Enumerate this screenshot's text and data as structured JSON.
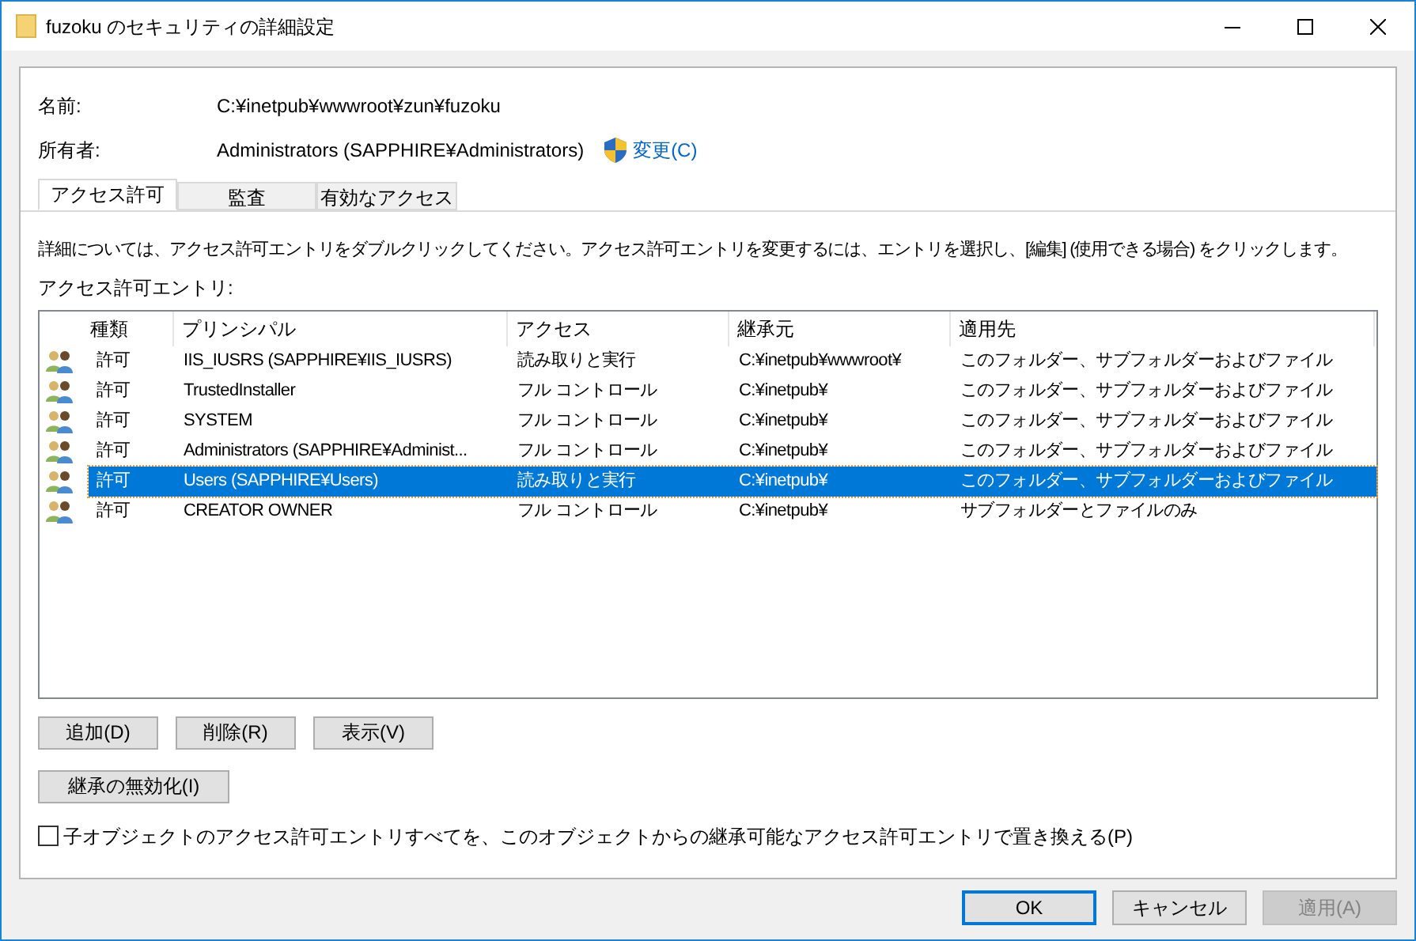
{
  "window": {
    "title": "fuzoku のセキュリティの詳細設定"
  },
  "name": {
    "label": "名前:",
    "value": "C:¥inetpub¥wwwroot¥zun¥fuzoku"
  },
  "owner": {
    "label": "所有者:",
    "value": "Administrators (SAPPHIRE¥Administrators)",
    "change_link": "変更(C)"
  },
  "tabs": [
    {
      "label": "アクセス許可",
      "selected": true
    },
    {
      "label": "監査",
      "selected": false
    },
    {
      "label": "有効なアクセス",
      "selected": false
    }
  ],
  "instructions": "詳細については、アクセス許可エントリをダブルクリックしてください。アクセス許可エントリを変更するには、エントリを選択し、[編集] (使用できる場合) をクリックします。",
  "list_label": "アクセス許可エントリ:",
  "table": {
    "columns": [
      "種類",
      "プリンシパル",
      "アクセス",
      "継承元",
      "適用先"
    ],
    "rows": [
      {
        "type": "許可",
        "principal": "IIS_IUSRS (SAPPHIRE¥IIS_IUSRS)",
        "access": "読み取りと実行",
        "inherited_from": "C:¥inetpub¥wwwroot¥",
        "applies_to": "このフォルダー、サブフォルダーおよびファイル",
        "selected": false
      },
      {
        "type": "許可",
        "principal": "TrustedInstaller",
        "access": "フル コントロール",
        "inherited_from": "C:¥inetpub¥",
        "applies_to": "このフォルダー、サブフォルダーおよびファイル",
        "selected": false
      },
      {
        "type": "許可",
        "principal": "SYSTEM",
        "access": "フル コントロール",
        "inherited_from": "C:¥inetpub¥",
        "applies_to": "このフォルダー、サブフォルダーおよびファイル",
        "selected": false
      },
      {
        "type": "許可",
        "principal": "Administrators (SAPPHIRE¥Administ...",
        "access": "フル コントロール",
        "inherited_from": "C:¥inetpub¥",
        "applies_to": "このフォルダー、サブフォルダーおよびファイル",
        "selected": false
      },
      {
        "type": "許可",
        "principal": "Users (SAPPHIRE¥Users)",
        "access": "読み取りと実行",
        "inherited_from": "C:¥inetpub¥",
        "applies_to": "このフォルダー、サブフォルダーおよびファイル",
        "selected": true
      },
      {
        "type": "許可",
        "principal": "CREATOR OWNER",
        "access": "フル コントロール",
        "inherited_from": "C:¥inetpub¥",
        "applies_to": "サブフォルダーとファイルのみ",
        "selected": false
      }
    ]
  },
  "entry_buttons": [
    "追加(D)",
    "削除(R)",
    "表示(V)"
  ],
  "disable_inheritance_button": "継承の無効化(I)",
  "replace_checkbox": {
    "label": "子オブジェクトのアクセス許可エントリすべてを、このオブジェクトからの継承可能なアクセス許可エントリで置き換える(P)",
    "checked": false
  },
  "footer_buttons": [
    {
      "label": "OK",
      "kind": "default"
    },
    {
      "label": "キャンセル",
      "kind": "normal"
    },
    {
      "label": "適用(A)",
      "kind": "disabled"
    }
  ]
}
